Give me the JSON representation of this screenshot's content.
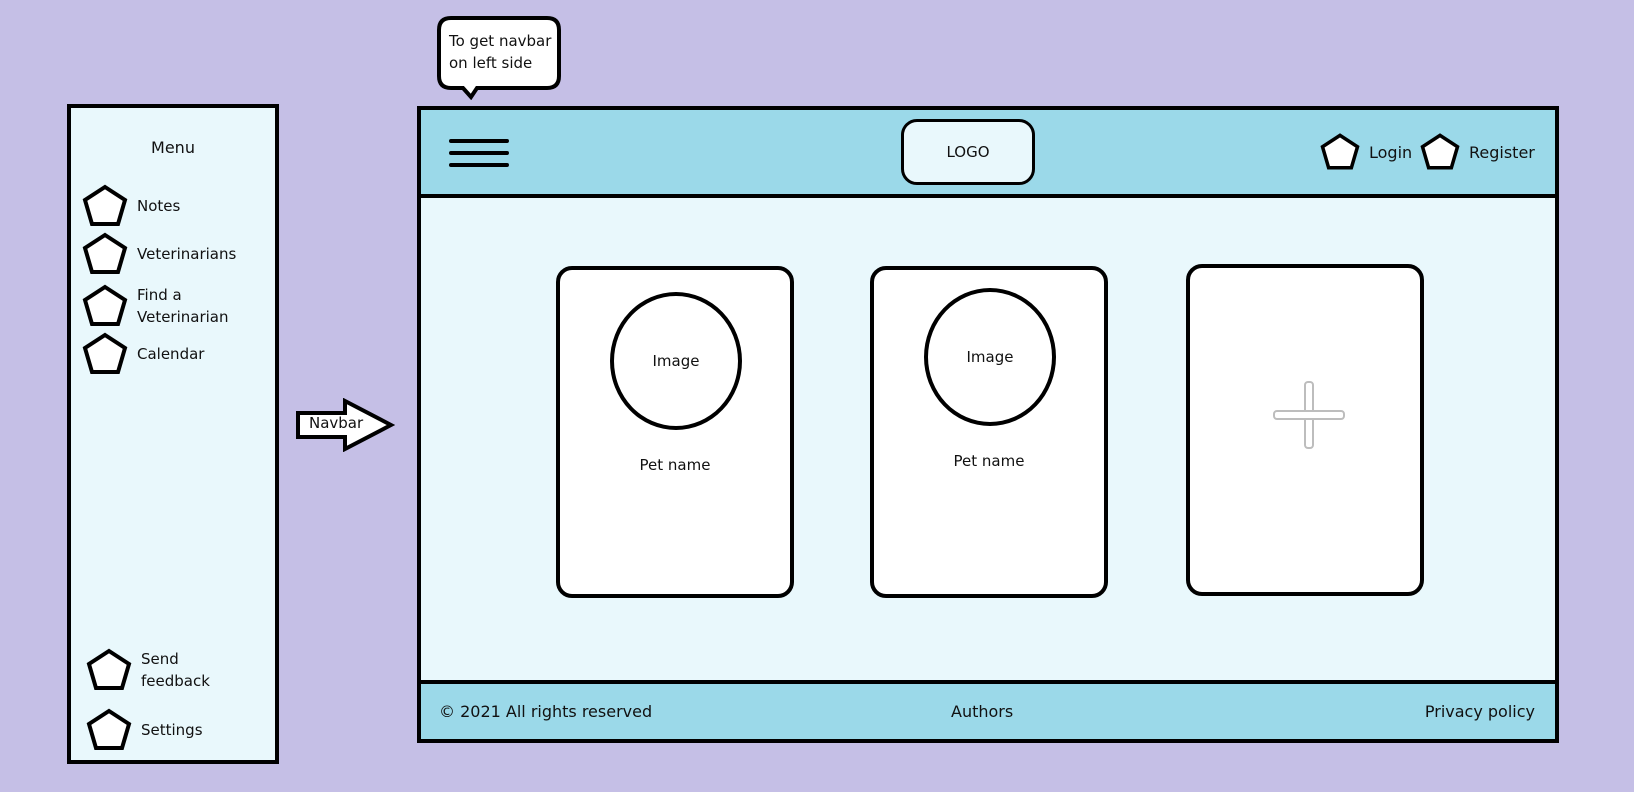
{
  "sidebar": {
    "title": "Menu",
    "items": [
      {
        "label": "Notes",
        "icon": "pentagon-icon"
      },
      {
        "label": "Veterinarians",
        "icon": "pentagon-icon"
      },
      {
        "label": "Find a\nVeterinarian",
        "icon": "pentagon-icon"
      },
      {
        "label": "Calendar",
        "icon": "pentagon-icon"
      },
      {
        "label": "Send\nfeedback",
        "icon": "pentagon-icon"
      },
      {
        "label": "Settings",
        "icon": "pentagon-icon"
      }
    ]
  },
  "arrow_label": "Navbar",
  "callout": "To get navbar on left side",
  "header": {
    "logo": "LOGO",
    "login": "Login",
    "register": "Register"
  },
  "cards": [
    {
      "image": "Image",
      "name": "Pet name"
    },
    {
      "image": "Image",
      "name": "Pet name"
    },
    {
      "add": "+"
    }
  ],
  "footer": {
    "copyright": "© 2021 All rights reserved",
    "authors": "Authors",
    "privacy": "Privacy policy"
  },
  "colors": {
    "background": "#c5bfe6",
    "panel": "#e9f8fc",
    "bar": "#9bd9e9"
  }
}
